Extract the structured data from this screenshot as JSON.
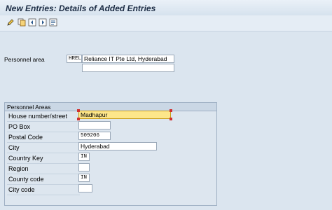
{
  "window": {
    "title": "New Entries: Details of Added Entries"
  },
  "toolbar": {
    "icons": [
      {
        "name": "edit-pencil-icon",
        "glyph": "✎",
        "color": "#2c5b8e"
      },
      {
        "name": "copy-as-icon",
        "glyph": "⧉",
        "color": "#8a5a12"
      },
      {
        "name": "previous-entry-icon",
        "glyph": "▤",
        "color": "#2c5b8e"
      },
      {
        "name": "next-entry-icon",
        "glyph": "▥",
        "color": "#2c5b8e"
      },
      {
        "name": "other-entry-icon",
        "glyph": "◨",
        "color": "#2c5b8e"
      }
    ]
  },
  "header": {
    "personnel_area_label": "Personnel area",
    "personnel_area_code": "HREL",
    "personnel_area_text": "Reliance IT Pte Ltd, Hyderabad",
    "personnel_area_text2": ""
  },
  "group": {
    "title": "Personnel Areas",
    "rows": [
      {
        "label": "House number/street",
        "value": "Madhapur"
      },
      {
        "label": "PO Box",
        "value": ""
      },
      {
        "label": "Postal Code",
        "value": "509206"
      },
      {
        "label": "City",
        "value": "Hyderabad"
      },
      {
        "label": "Country Key",
        "value": "IN"
      },
      {
        "label": "Region",
        "value": ""
      },
      {
        "label": "County code",
        "value": "IN"
      },
      {
        "label": "City code",
        "value": ""
      }
    ]
  },
  "colors": {
    "active_field": "#fde68a",
    "title_text": "#1c2c44",
    "background": "#dbe5ef"
  }
}
